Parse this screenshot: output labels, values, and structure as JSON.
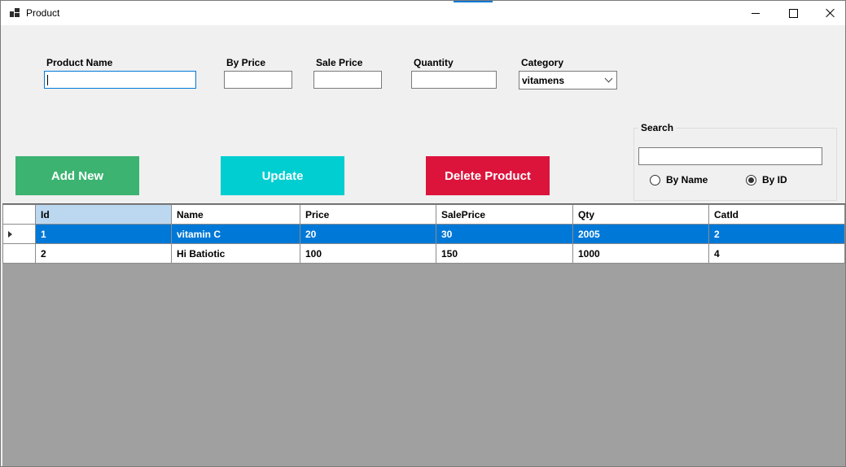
{
  "window": {
    "title": "Product",
    "controls": [
      "minimize",
      "maximize",
      "close"
    ]
  },
  "form": {
    "product_name_label": "Product Name",
    "product_name_value": "",
    "by_price_label": "By Price",
    "by_price_value": "",
    "sale_price_label": "Sale Price",
    "sale_price_value": "",
    "quantity_label": "Quantity",
    "quantity_value": "",
    "category_label": "Category",
    "category_value": "vitamens"
  },
  "buttons": {
    "add_label": "Add New",
    "update_label": "Update",
    "delete_label": "Delete Product"
  },
  "search": {
    "title": "Search",
    "value": "",
    "option_name": "By Name",
    "option_id": "By ID",
    "selected_option": "By ID"
  },
  "grid": {
    "columns": [
      "Id",
      "Name",
      "Price",
      "SalePrice",
      "Qty",
      "CatId"
    ],
    "rows": [
      [
        "1",
        "vitamin C",
        "20",
        "30",
        "2005",
        "2"
      ],
      [
        "2",
        "Hi Batiotic",
        "100",
        "150",
        "1000",
        "4"
      ]
    ],
    "selected_row": 0
  },
  "colors": {
    "add_button": "#3cb371",
    "update_button": "#00ced1",
    "delete_button": "#dc143c",
    "selection": "#0078d7",
    "grid_background": "#a0a0a0"
  }
}
